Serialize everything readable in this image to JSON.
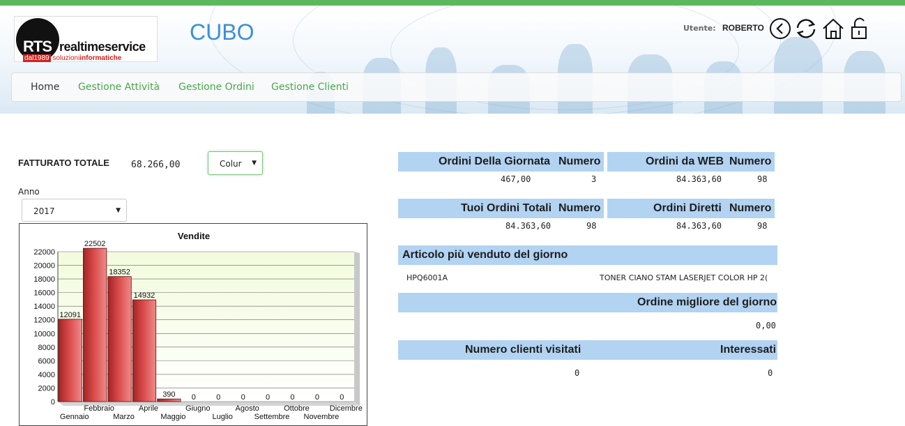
{
  "header": {
    "app_title": "CUBO",
    "user_label": "Utente:",
    "user_name": "ROBERTO",
    "logo": {
      "rts": "RTS",
      "brand_a": "realtime",
      "brand_b": "service",
      "year": "dal1989",
      "tag_a": "soluzioni",
      "tag_b": "informatiche"
    },
    "icons": [
      "back-circle-icon",
      "refresh-icon",
      "home-icon",
      "unlock-icon"
    ]
  },
  "nav": {
    "home": "Home",
    "attivita": "Gestione Attività",
    "ordini": "Gestione Ordini",
    "clienti": "Gestione Clienti"
  },
  "filters": {
    "fatturato_label": "FATTURATO TOTALE",
    "fatturato_value": "68.266,00",
    "colur_select": "Colur",
    "anno_label": "Anno",
    "anno_select": "2017"
  },
  "stats": {
    "ordini_giornata": {
      "title": "Ordini Della Giornata",
      "col": "Numero",
      "value": "467,00",
      "count": "3"
    },
    "ordini_web": {
      "title": "Ordini da WEB",
      "col": "Numero",
      "value": "84.363,60",
      "count": "98"
    },
    "ordini_totali": {
      "title": "Tuoi Ordini Totali",
      "col": "Numero",
      "value": "84.363,60",
      "count": "98"
    },
    "ordini_diretti": {
      "title": "Ordini Diretti",
      "col": "Numero",
      "value": "84.363,60",
      "count": "98"
    },
    "articolo": {
      "title": "Articolo più venduto del giorno",
      "code": "HPQ6001A",
      "desc": "TONER CIANO STAM LASERJET COLOR HP 2("
    },
    "ordine_migliore": {
      "title": "Ordine migliore del giorno",
      "value": "0,00"
    },
    "clienti": {
      "title_a": "Numero clienti visitati",
      "title_b": "Interessati",
      "value_a": "0",
      "value_b": "0"
    }
  },
  "colors": {
    "accent_green": "#5cb85c",
    "nav_green": "#4aa64a",
    "title_blue": "#3a8fd9",
    "table_header": "#b2d3f2",
    "bar_red": "#d94a4a"
  },
  "chart_data": {
    "type": "bar",
    "title": "Vendite",
    "categories": [
      "Gennaio",
      "Febbraio",
      "Marzo",
      "Aprile",
      "Maggio",
      "Giugno",
      "Luglio",
      "Agosto",
      "Settembre",
      "Ottobre",
      "Novembre",
      "Dicembre"
    ],
    "values": [
      12091,
      22502,
      18352,
      14932,
      390,
      0,
      0,
      0,
      0,
      0,
      0,
      0
    ],
    "ylim": [
      0,
      22000
    ],
    "yticks": [
      0,
      2000,
      4000,
      6000,
      8000,
      10000,
      12000,
      14000,
      16000,
      18000,
      20000,
      22000
    ],
    "grid": true,
    "legend": "none"
  }
}
